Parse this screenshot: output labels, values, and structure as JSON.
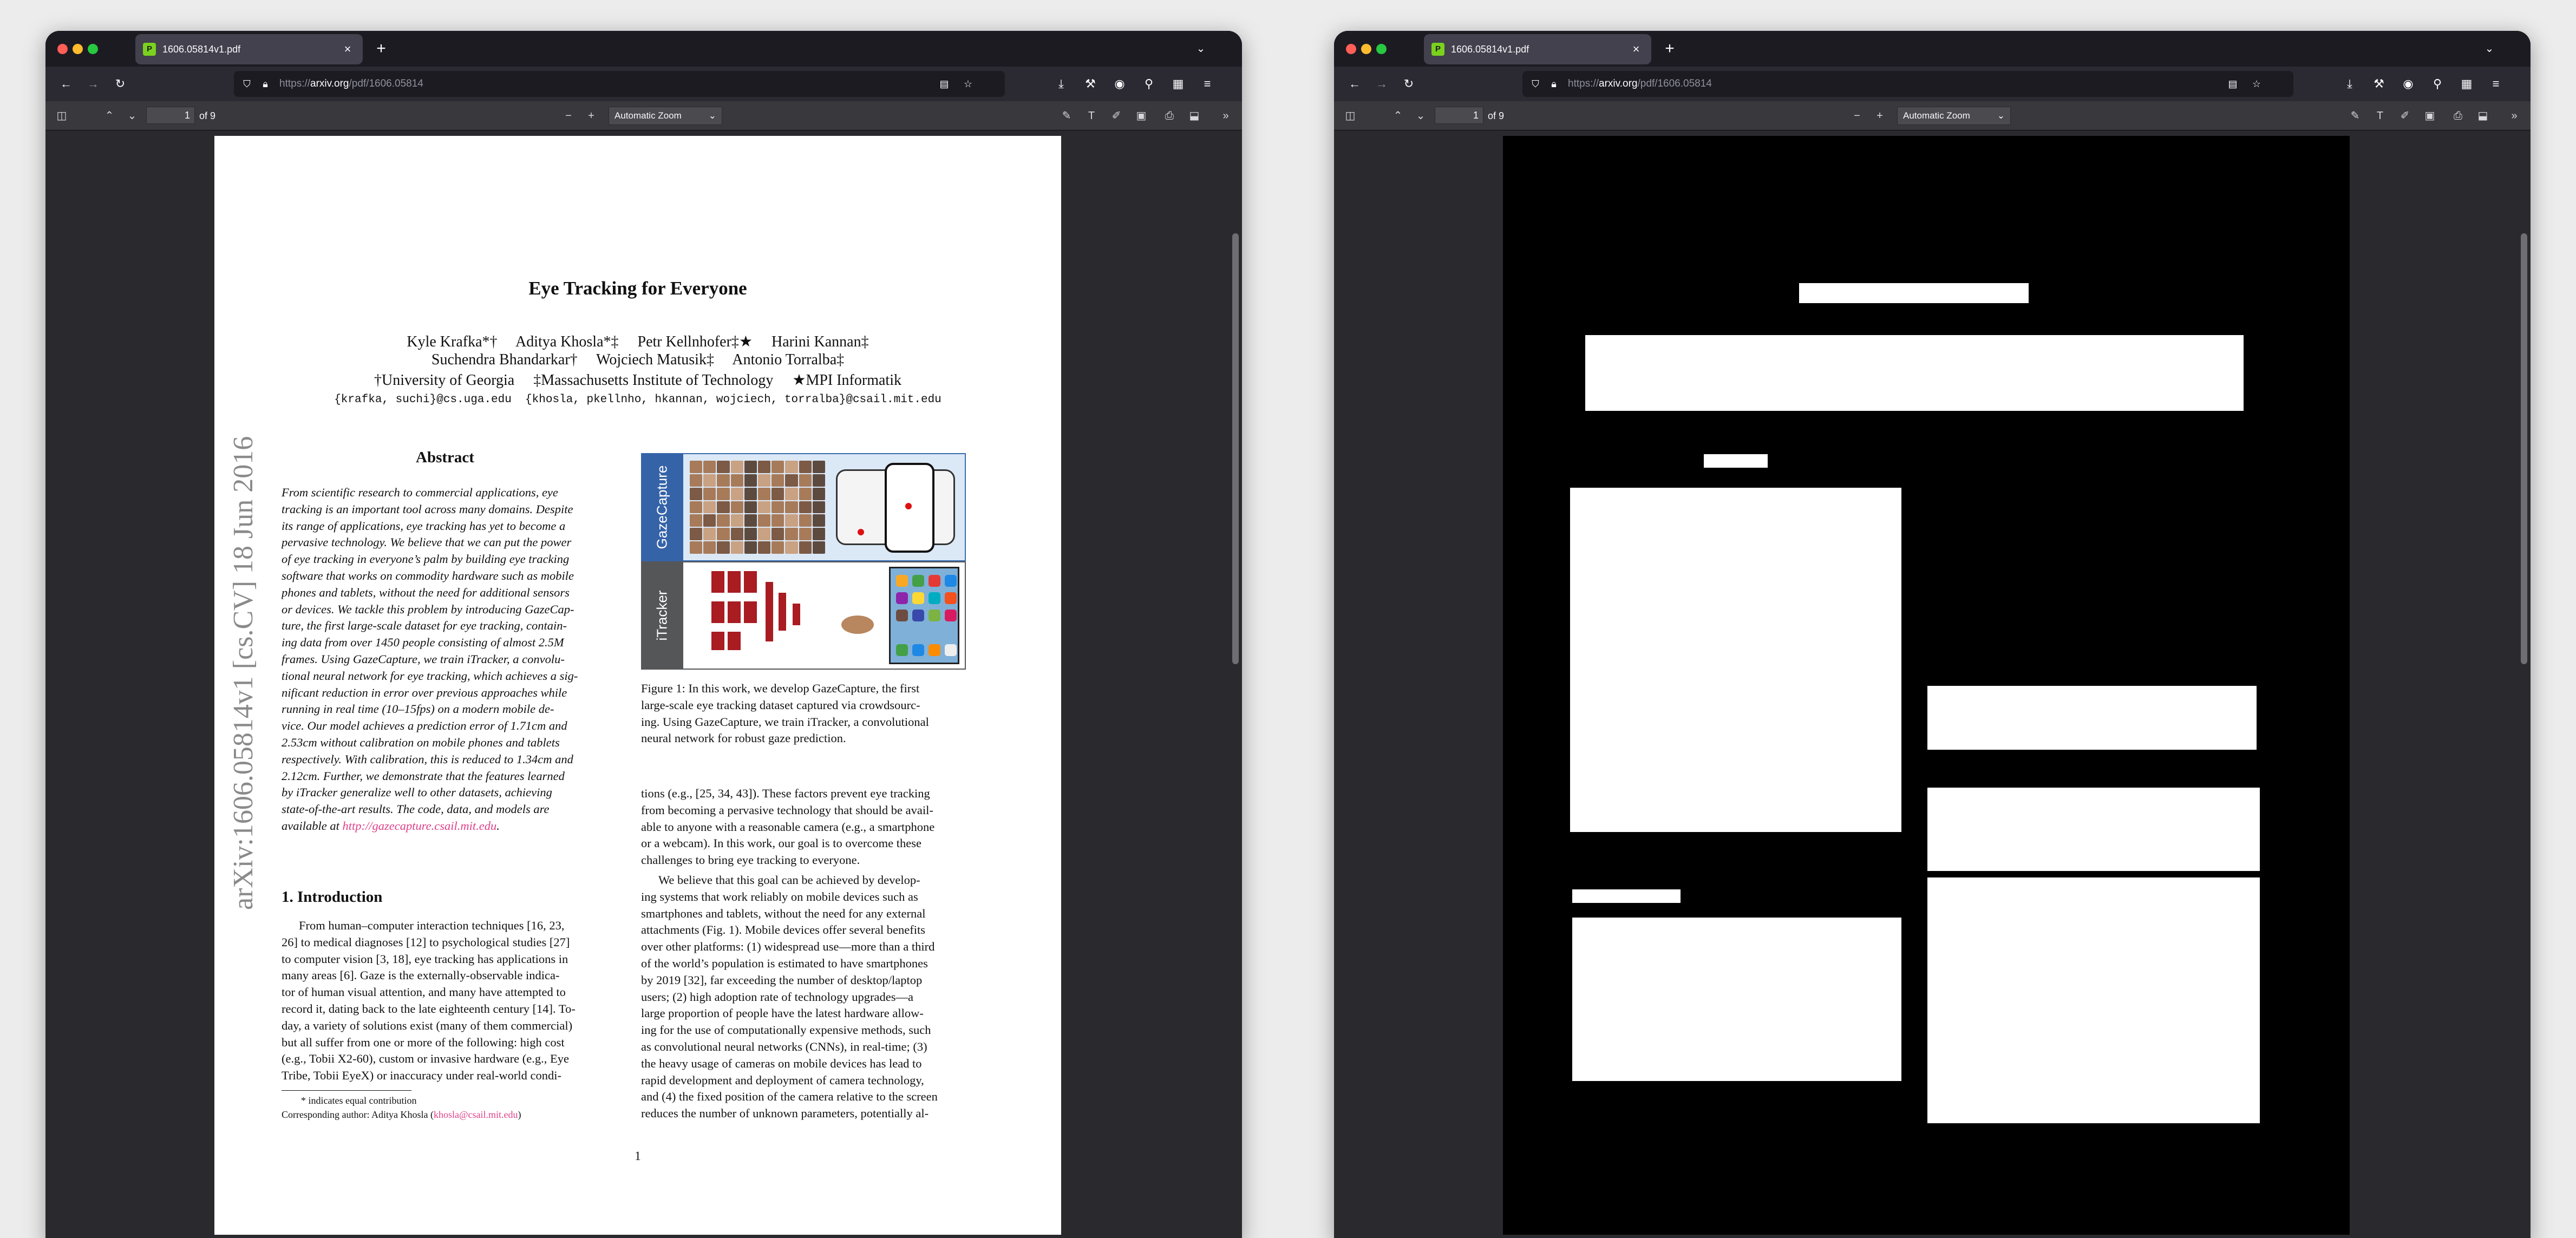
{
  "browser": {
    "tab_title": "1606.05814v1.pdf",
    "tab_favicon_letter": "P",
    "close_glyph": "×",
    "new_tab_glyph": "+",
    "tab_list_glyph": "⌄",
    "url_prefix": "https://",
    "url_domain": "arxiv.org",
    "url_path": "/pdf/1606.05814"
  },
  "pdf_toolbar": {
    "page_number": "1",
    "page_count_label": "of 9",
    "zoom_label": "Automatic Zoom",
    "zoom_out": "−",
    "zoom_in": "+"
  },
  "paper": {
    "title": "Eye Tracking for Everyone",
    "author_line_1": "Kyle Krafka*†     Aditya Khosla*‡     Petr Kellnhofer‡★     Harini Kannan‡",
    "author_line_2": "Suchendra Bhandarkar†     Wojciech Matusik‡     Antonio Torralba‡",
    "affiliations": "†University of Georgia     ‡Massachusetts Institute of Technology     ★MPI Informatik",
    "emails": "{krafka, suchi}@cs.uga.edu  {khosla, pkellnho, hkannan, wojciech, torralba}@csail.mit.edu",
    "arxiv_stamp": "arXiv:1606.05814v1  [cs.CV]  18 Jun 2016",
    "abstract_heading": "Abstract",
    "abstract_lines": [
      "From scientific research to commercial applications, eye",
      "tracking is an important tool across many domains. Despite",
      "its range of applications, eye tracking has yet to become a",
      "pervasive technology. We believe that we can put the power",
      "of eye tracking in everyone’s palm by building eye tracking",
      "software that works on commodity hardware such as mobile",
      "phones and tablets, without the need for additional sensors",
      "or devices. We tackle this problem by introducing GazeCap-",
      "ture, the first large-scale dataset for eye tracking, contain-",
      "ing data from over 1450 people consisting of almost 2.5M",
      "frames. Using GazeCapture, we train iTracker, a convolu-",
      "tional neural network for eye tracking, which achieves a sig-",
      "nificant reduction in error over previous approaches while",
      "running in real time (10–15fps) on a modern mobile de-",
      "vice. Our model achieves a prediction error of 1.71cm and",
      "2.53cm without calibration on mobile phones and tablets",
      "respectively. With calibration, this is reduced to 1.34cm and",
      "2.12cm. Further, we demonstrate that the features learned",
      "by iTracker generalize well to other datasets, achieving",
      "state-of-the-art results.  The code, data, and models are",
      "available at "
    ],
    "abstract_link": "http://gazecapture.csail.mit.edu",
    "abstract_link_tail": ".",
    "intro_heading": "1. Introduction",
    "intro_lines": [
      "From human–computer interaction techniques [16, 23,",
      "26] to medical diagnoses [12] to psychological studies [27]",
      "to computer vision [3, 18], eye tracking has applications in",
      "many areas [6].  Gaze is the externally-observable indica-",
      "tor of human visual attention, and many have attempted to",
      "record it, dating back to the late eighteenth century [14]. To-",
      "day, a variety of solutions exist (many of them commercial)",
      "but all suffer from one or more of the following: high cost",
      "(e.g., Tobii X2-60), custom or invasive hardware (e.g., Eye",
      "Tribe, Tobii EyeX) or inaccuracy under real-world condi-"
    ],
    "footnote_1": "* indicates equal contribution",
    "footnote_2_prefix": "Corresponding author: Aditya Khosla (",
    "footnote_2_link": "khosla@csail.mit.edu",
    "footnote_2_suffix": ")",
    "figure_label_top": "GazeCapture",
    "figure_label_bottom": "iTracker",
    "caption_lines": [
      "Figure 1:  In this work, we develop GazeCapture, the first",
      "large-scale eye tracking dataset captured via crowdsourc-",
      "ing. Using GazeCapture, we train iTracker, a convolutional",
      "neural network for robust gaze prediction."
    ],
    "right_lines": [
      "tions (e.g., [25, 34, 43]). These factors prevent eye tracking",
      "from becoming a pervasive technology that should be avail-",
      "able to anyone with a reasonable camera (e.g., a smartphone",
      "or a webcam). In this work, our goal is to overcome these",
      "challenges to bring eye tracking to everyone.",
      "We believe that this goal can be achieved by develop-",
      "ing systems that work reliably on mobile devices such as",
      "smartphones and tablets, without the need for any external",
      "attachments (Fig. 1).  Mobile devices offer several benefits",
      "over other platforms: (1) widespread use—more than a third",
      "of the world’s population is estimated to have smartphones",
      "by 2019 [32], far exceeding the number of desktop/laptop",
      "users; (2) high adoption rate of technology upgrades—a",
      "large proportion of people have the latest hardware allow-",
      "ing for the use of computationally expensive methods, such",
      "as convolutional neural networks (CNNs), in real-time; (3)",
      "the heavy usage of cameras on mobile devices has lead to",
      "rapid development and deployment of camera technology,",
      "and (4) the fixed position of the camera relative to the screen",
      "reduces the number of unknown parameters, potentially al-"
    ],
    "page_number": "1"
  }
}
